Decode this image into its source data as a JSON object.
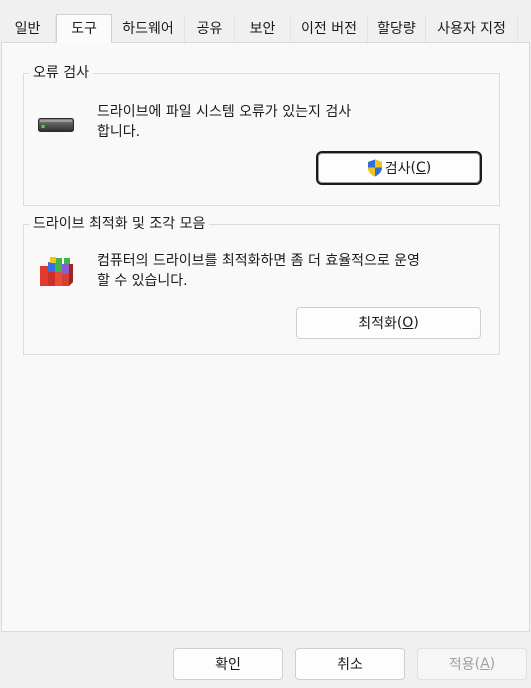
{
  "tabs": [
    {
      "label": "일반"
    },
    {
      "label": "도구"
    },
    {
      "label": "하드웨어"
    },
    {
      "label": "공유"
    },
    {
      "label": "보안"
    },
    {
      "label": "이전 버전"
    },
    {
      "label": "할당량"
    },
    {
      "label": "사용자 지정"
    }
  ],
  "error_check": {
    "title": "오류 검사",
    "desc_line1": "드라이브에 파일 시스템 오류가 있는지 검사",
    "desc_line2": "합니다.",
    "button_text": "검사",
    "button_mnemonic": "C",
    "icon": "drive-icon",
    "button_icon": "uac-shield-icon"
  },
  "optimize": {
    "title": "드라이브 최적화 및 조각 모음",
    "desc_line1": "컴퓨터의 드라이브를 최적화하면 좀 더 효율적으로 운영",
    "desc_line2": "할 수 있습니다.",
    "button_text": "최적화",
    "button_mnemonic": "O",
    "icon": "defrag-icon"
  },
  "footer": {
    "ok": "확인",
    "cancel": "취소",
    "apply_text": "적용",
    "apply_mnemonic": "A"
  }
}
